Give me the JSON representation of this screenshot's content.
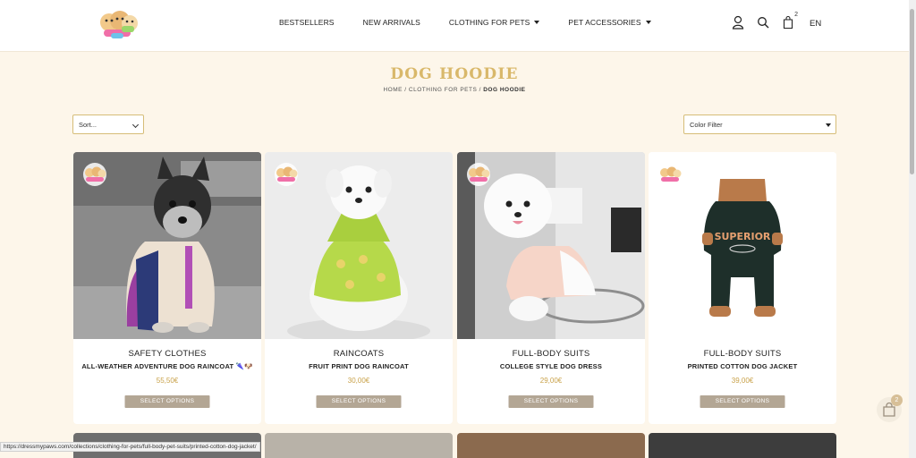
{
  "header": {
    "nav": [
      {
        "label": "BESTSELLERS",
        "has_caret": false
      },
      {
        "label": "NEW ARRIVALS",
        "has_caret": false
      },
      {
        "label": "CLOTHING FOR PETS",
        "has_caret": true
      },
      {
        "label": "PET ACCESSORIES",
        "has_caret": true
      }
    ],
    "icons": [
      "user-icon",
      "search-icon",
      "cart-icon"
    ],
    "cart_count": "2",
    "language": "EN"
  },
  "page": {
    "title": "DOG HOODIE",
    "breadcrumb": {
      "home": "HOME",
      "category": "CLOTHING FOR PETS",
      "current": "DOG HOODIE",
      "separator": " / "
    }
  },
  "filters": {
    "sort_value": "Sort...",
    "color_value": "Color Filter"
  },
  "products": [
    {
      "category": "SAFETY CLOTHES",
      "name": "ALL-WEATHER ADVENTURE DOG RAINCOAT",
      "emoji": "🌂🐶",
      "price": "55,50€",
      "button": "SELECT OPTIONS"
    },
    {
      "category": "RAINCOATS",
      "name": "FRUIT PRINT DOG RAINCOAT",
      "emoji": "",
      "price": "30,00€",
      "button": "SELECT OPTIONS"
    },
    {
      "category": "FULL-BODY SUITS",
      "name": "COLLEGE STYLE DOG DRESS",
      "emoji": "",
      "price": "29,00€",
      "button": "SELECT OPTIONS"
    },
    {
      "category": "FULL-BODY SUITS",
      "name": "PRINTED COTTON DOG JACKET",
      "emoji": "",
      "price": "39,00€",
      "button": "SELECT OPTIONS"
    }
  ],
  "floating_cart": {
    "count": "2"
  },
  "status_bar": {
    "url": "https://dressmypaws.com/collections/clothing-for-pets/full-body-pet-suits/printed-cotton-dog-jacket/"
  },
  "colors": {
    "accent": "#d9b86a",
    "button": "#b3a694",
    "background": "#fdf6ea",
    "price": "#c9a24a"
  }
}
